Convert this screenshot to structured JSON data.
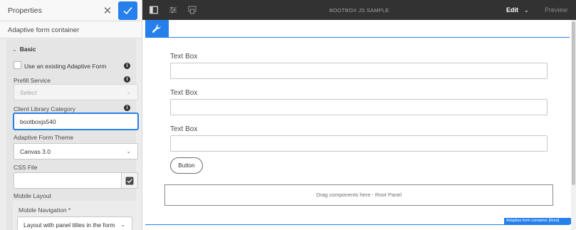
{
  "properties_panel": {
    "title": "Properties",
    "close_glyph": "✕",
    "confirm_icon": "checkmark-icon",
    "component_name": "Adaptive form container",
    "section": {
      "chevron": "⌄",
      "label": "Basic"
    },
    "use_existing_form": {
      "label": "Use an existing Adaptive Form",
      "checked": false
    },
    "prefill_service": {
      "label": "Prefill Service",
      "placeholder": "Select",
      "caret": "⌄"
    },
    "client_library_category": {
      "label": "Client Library Category",
      "value": "bootboxjs540"
    },
    "adaptive_form_theme": {
      "label": "Adaptive Form Theme",
      "value": "Canvas 3.0",
      "caret": "⌄"
    },
    "css_file": {
      "label": "CSS File",
      "value": ""
    },
    "mobile_layout": {
      "label": "Mobile Layout",
      "navigation_label": "Mobile Navigation *",
      "navigation_value": "Layout with panel titles in the form he...",
      "caret": "⌄"
    },
    "info_glyph": "i"
  },
  "toolbar": {
    "title": "BOOTBOX JS SAMPLE",
    "mode": "Edit",
    "mode_caret": "⌄",
    "preview": "Preview",
    "icons": [
      "side-panel-icon",
      "properties-icon",
      "emulator-icon"
    ]
  },
  "form": {
    "tool_icon": "wrench-icon",
    "text_boxes": [
      {
        "label": "Text Box",
        "value": ""
      },
      {
        "label": "Text Box",
        "value": ""
      },
      {
        "label": "Text Box",
        "value": ""
      }
    ],
    "button_label": "Button",
    "drop_zone_text": "Drag components here - Root Panel",
    "selected_component_badge": "Adaptive form container [Root]"
  },
  "colors": {
    "accent": "#2680eb",
    "toolbar_bg": "#323232",
    "panel_bg": "#ededed"
  }
}
